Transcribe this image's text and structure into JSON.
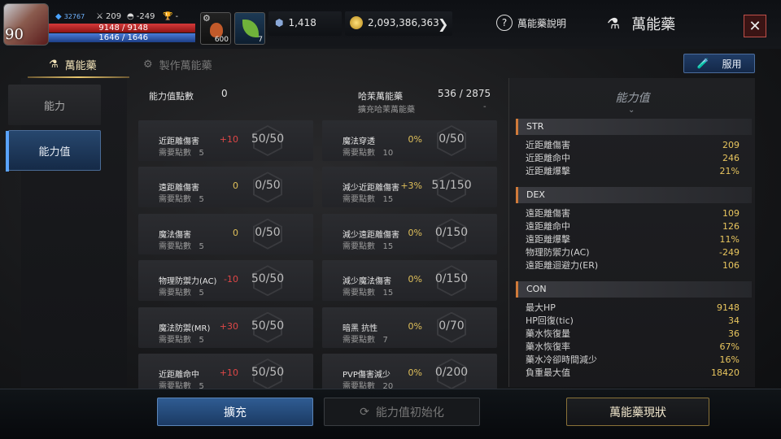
{
  "header": {
    "level": "90",
    "power": "32767",
    "attack": "209",
    "defense": "-249",
    "trophy": "-",
    "hp": "9148 / 9148",
    "mp": "1646 / 1646",
    "slot1_count": "600",
    "slot2_count": "7",
    "currency1": "1,418",
    "currency2": "2,093,386,363",
    "help_label": "萬能藥說明",
    "title": "萬能藥",
    "colors": {
      "accent": "#e0c05a",
      "hp": "#c62e2e",
      "mp": "#2f5ab0",
      "negative": "#e04747"
    }
  },
  "tabs": {
    "active": "萬能藥",
    "inactive": "製作萬能藥"
  },
  "use_button": "服用",
  "nav": {
    "items": [
      "能力",
      "能力值"
    ],
    "selected": "能力值"
  },
  "summary": {
    "points_label": "能力值點數",
    "points_value": "0",
    "elixir_label": "哈茉萬能藥",
    "elixir_value": "536 / 2875",
    "expand_label": "擴充哈茉萬能藥",
    "expand_value": "-"
  },
  "cards_left": [
    {
      "name": "近距離傷害",
      "pts_label": "需要點數",
      "pts": "5",
      "bonus": "+10",
      "value": "50/50"
    },
    {
      "name": "遠距離傷害",
      "pts_label": "需要點數",
      "pts": "5",
      "bonus": "0",
      "value": "0/50"
    },
    {
      "name": "魔法傷害",
      "pts_label": "需要點數",
      "pts": "5",
      "bonus": "0",
      "value": "0/50"
    },
    {
      "name": "物理防禦力(AC)",
      "pts_label": "需要點數",
      "pts": "5",
      "bonus": "-10",
      "value": "50/50"
    },
    {
      "name": "魔法防禦(MR)",
      "pts_label": "需要點數",
      "pts": "5",
      "bonus": "+30",
      "value": "50/50"
    },
    {
      "name": "近距離命中",
      "pts_label": "需要點數",
      "pts": "5",
      "bonus": "+10",
      "value": "50/50"
    }
  ],
  "cards_right": [
    {
      "name": "魔法穿透",
      "pts_label": "需要點數",
      "pts": "10",
      "bonus": "0%",
      "value": "0/50"
    },
    {
      "name": "減少近距離傷害",
      "pts_label": "需要點數",
      "pts": "15",
      "bonus": "+3%",
      "value": "51/150"
    },
    {
      "name": "減少遠距離傷害",
      "pts_label": "需要點數",
      "pts": "15",
      "bonus": "0%",
      "value": "0/150"
    },
    {
      "name": "減少魔法傷害",
      "pts_label": "需要點數",
      "pts": "15",
      "bonus": "0%",
      "value": "0/150"
    },
    {
      "name": "暗黑 抗性",
      "pts_label": "需要點數",
      "pts": "7",
      "bonus": "0%",
      "value": "0/70"
    },
    {
      "name": "PVP傷害減少",
      "pts_label": "需要點數",
      "pts": "20",
      "bonus": "0%",
      "value": "0/200"
    }
  ],
  "stats_panel": {
    "title": "能力值",
    "sections": [
      {
        "name": "STR",
        "rows": [
          {
            "label": "近距離傷害",
            "value": "209"
          },
          {
            "label": "近距離命中",
            "value": "246"
          },
          {
            "label": "近距離爆擊",
            "value": "21%"
          }
        ]
      },
      {
        "name": "DEX",
        "rows": [
          {
            "label": "遠距離傷害",
            "value": "109"
          },
          {
            "label": "遠距離命中",
            "value": "126"
          },
          {
            "label": "遠距離爆擊",
            "value": "11%"
          },
          {
            "label": "物理防禦力(AC)",
            "value": "-249"
          },
          {
            "label": "遠距離迴避力(ER)",
            "value": "106"
          }
        ]
      },
      {
        "name": "CON",
        "rows": [
          {
            "label": "最大HP",
            "value": "9148"
          },
          {
            "label": "HP回復(tic)",
            "value": "34"
          },
          {
            "label": "藥水恢復量",
            "value": "36"
          },
          {
            "label": "藥水恢復率",
            "value": "67%"
          },
          {
            "label": "藥水冷卻時間減少",
            "value": "16%"
          },
          {
            "label": "負重最大值",
            "value": "18420"
          }
        ]
      }
    ]
  },
  "bottom": {
    "expand": "擴充",
    "reset": "能力值初始化",
    "status": "萬能藥現狀"
  }
}
